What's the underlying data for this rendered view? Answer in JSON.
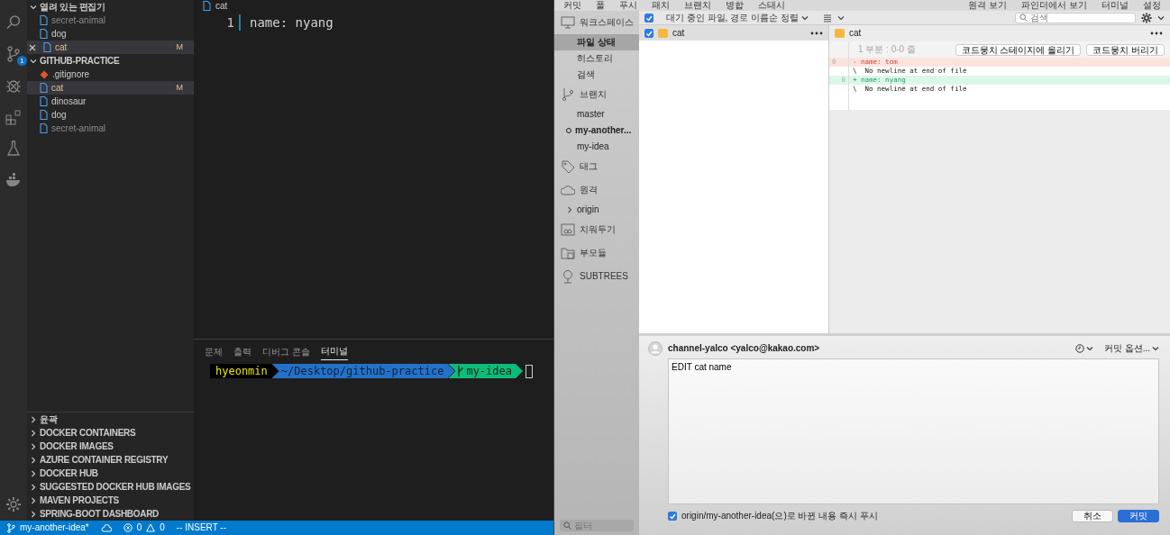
{
  "vscode": {
    "activity_bar": {
      "badge": "1"
    },
    "open_editors": {
      "title": "열려 있는 편집기",
      "expanded": true,
      "items": [
        {
          "name": "secret-animal",
          "kind": "file",
          "ignored": true,
          "selected": false
        },
        {
          "name": "dog",
          "kind": "file",
          "ignored": false,
          "selected": false
        },
        {
          "name": "cat",
          "kind": "file",
          "ignored": false,
          "selected": true,
          "status": "M"
        }
      ]
    },
    "explorer": {
      "title": "GITHUB-PRACTICE",
      "expanded": true,
      "items": [
        {
          "name": ".gitignore",
          "kind": "gitignore",
          "ignored": false,
          "selected": false
        },
        {
          "name": "cat",
          "kind": "file",
          "ignored": false,
          "selected": true,
          "status": "M"
        },
        {
          "name": "dinosaur",
          "kind": "file",
          "ignored": false,
          "selected": false
        },
        {
          "name": "dog",
          "kind": "file",
          "ignored": false,
          "selected": false
        },
        {
          "name": "secret-animal",
          "kind": "file",
          "ignored": true,
          "selected": false
        }
      ]
    },
    "panels": [
      {
        "title": "윤곽",
        "expanded": false
      },
      {
        "title": "DOCKER CONTAINERS",
        "expanded": false
      },
      {
        "title": "DOCKER IMAGES",
        "expanded": false
      },
      {
        "title": "AZURE CONTAINER REGISTRY",
        "expanded": false
      },
      {
        "title": "DOCKER HUB",
        "expanded": false
      },
      {
        "title": "SUGGESTED DOCKER HUB IMAGES",
        "expanded": false
      },
      {
        "title": "MAVEN PROJECTS",
        "expanded": false
      },
      {
        "title": "SPRING-BOOT DASHBOARD",
        "expanded": false
      }
    ],
    "editor": {
      "tab": "cat",
      "lines": [
        {
          "number": "1",
          "text": "name: nyang"
        }
      ]
    },
    "panel": {
      "tabs": [
        {
          "label": "문제",
          "selected": false
        },
        {
          "label": "출력",
          "selected": false
        },
        {
          "label": "디버그 콘솔",
          "selected": false
        },
        {
          "label": "터미널",
          "selected": true
        }
      ],
      "prompt": [
        {
          "kind": "user",
          "text": "hyeonmin",
          "color": "#000000"
        },
        {
          "kind": "path",
          "text": "~/Desktop/github-practice",
          "color": "#2472c8"
        },
        {
          "kind": "branch",
          "text": "my-idea",
          "color": "#0dbc79"
        }
      ]
    },
    "status_bar": {
      "branch": "my-another-idea*",
      "errors": "0",
      "warnings": "0",
      "mode": "-- INSERT --"
    }
  },
  "sourcetree": {
    "toolbar_left": [
      "커밋",
      "풀",
      "푸시",
      "패치",
      "브랜치",
      "병합",
      "스태시"
    ],
    "toolbar_right": [
      "원격 보기",
      "파인더에서 보기",
      "터미널",
      "설정"
    ],
    "sidebar": [
      {
        "title": "워크스페이스",
        "items": [
          {
            "label": "파일 상태",
            "selected": true
          },
          {
            "label": "히스토리",
            "selected": false
          },
          {
            "label": "검색",
            "selected": false
          }
        ]
      },
      {
        "title": "브랜치",
        "items": [
          {
            "label": "master",
            "current": false
          },
          {
            "label": "my-another...",
            "current": true
          },
          {
            "label": "my-idea",
            "current": false
          }
        ]
      },
      {
        "title": "태그"
      },
      {
        "title": "원격",
        "items": [
          {
            "label": "origin",
            "expanded": false
          }
        ]
      },
      {
        "title": "치워두기"
      },
      {
        "title": "부모듈"
      },
      {
        "title": "SUBTREES"
      }
    ],
    "filter": {
      "placeholder": "필터"
    },
    "file_list": {
      "stage_all": true,
      "sort": "대기 중인 파일, 경로 이름순 정렬",
      "files": [
        {
          "name": "cat",
          "checked": true,
          "selected": true
        }
      ]
    },
    "search": {
      "placeholder": "검색"
    },
    "diff": {
      "file": "cat",
      "hunk": "1 부분 : 0-0 줄",
      "buttons": [
        "코드뭉치 스테이지에 올리기",
        "코드뭉치 버리기"
      ],
      "lines": [
        {
          "kind": "removed",
          "old": "0",
          "text": "- name: tom"
        },
        {
          "kind": "context",
          "text": "\\  No newline at end of file"
        },
        {
          "kind": "added",
          "new": "0",
          "text": "+ name: nyang"
        },
        {
          "kind": "context",
          "text": "\\  No newline at end of file"
        }
      ]
    },
    "commit": {
      "author": "channel-yalco <yalco@kakao.com>",
      "options": "커밋 옵션...",
      "message": "EDIT cat name",
      "push": {
        "checked": true,
        "label": "origin/my-another-idea(으)로 바뀐 내용 즉시 푸시"
      },
      "buttons": [
        {
          "label": "취소",
          "primary": false
        },
        {
          "label": "커밋",
          "primary": true
        }
      ]
    }
  }
}
